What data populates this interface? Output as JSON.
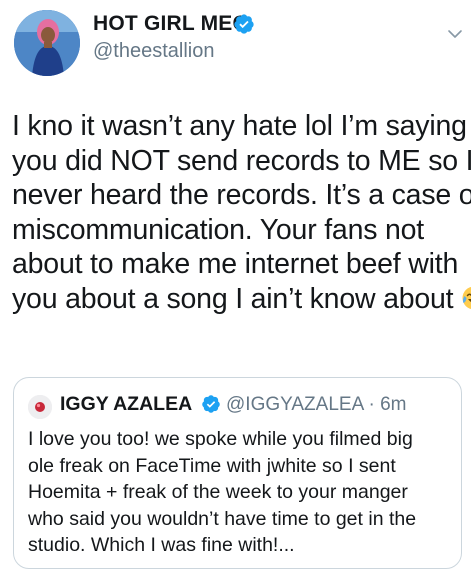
{
  "author": {
    "display_name": "HOT GIRL MEG",
    "handle": "@theestallion",
    "verified": true,
    "avatar_icon": "profile-photo"
  },
  "tweet": {
    "lines": [
      "I kno it wasn’t any hate lol I’m saying",
      "you did NOT send records to ME so I",
      "never heard the records. It’s a case of",
      "miscommunication. Your fans not",
      "about to make me internet beef with",
      "you about a song I ain’t know about"
    ],
    "emoji": "face-with-tears-of-joy"
  },
  "quoted_tweet": {
    "display_name": "IGGY AZALEA",
    "meta": "@IGGYAZALEA · 6m",
    "verified": true,
    "lines": [
      "I love you too! we spoke while you filmed big",
      "ole freak on FaceTime with jwhite so I sent",
      "Hoemita + freak of the week to your manger",
      "who said you wouldn’t have time to get in the",
      "studio. Which I was fine with!..."
    ]
  },
  "colors": {
    "verified_blue": "#1da1f2",
    "secondary_text": "#657786",
    "border": "#ccd6dd"
  }
}
